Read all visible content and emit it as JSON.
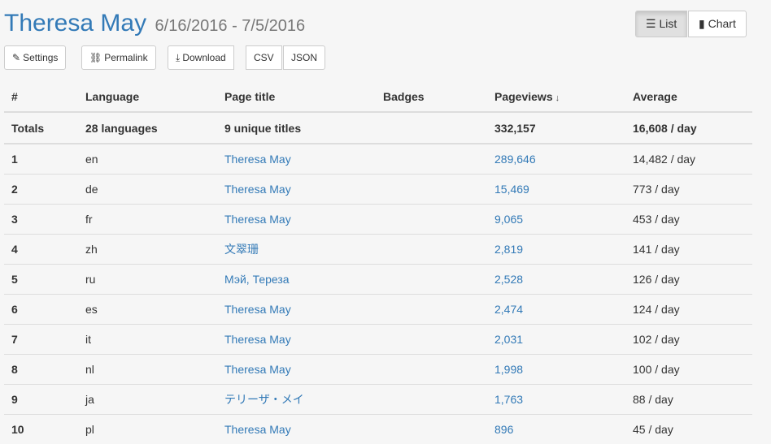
{
  "header": {
    "title": "Theresa May",
    "dates": "6/16/2016 - 7/5/2016"
  },
  "toolbar": {
    "settings_label": "Settings",
    "permalink_label": "Permalink",
    "download_label": "Download",
    "csv_label": "CSV",
    "json_label": "JSON",
    "list_label": "List",
    "chart_label": "Chart"
  },
  "table": {
    "columns": [
      "#",
      "Language",
      "Page title",
      "Badges",
      "Pageviews",
      "Average"
    ],
    "totals": {
      "label": "Totals",
      "languages": "28 languages",
      "titles": "9 unique titles",
      "pageviews": "332,157",
      "average": "16,608 / day"
    },
    "rows": [
      {
        "n": "1",
        "lang": "en",
        "title": "Theresa May",
        "views": "289,646",
        "avg": "14,482 / day"
      },
      {
        "n": "2",
        "lang": "de",
        "title": "Theresa May",
        "views": "15,469",
        "avg": "773 / day"
      },
      {
        "n": "3",
        "lang": "fr",
        "title": "Theresa May",
        "views": "9,065",
        "avg": "453 / day"
      },
      {
        "n": "4",
        "lang": "zh",
        "title": "文翠珊",
        "views": "2,819",
        "avg": "141 / day"
      },
      {
        "n": "5",
        "lang": "ru",
        "title": "Мэй, Тереза",
        "views": "2,528",
        "avg": "126 / day"
      },
      {
        "n": "6",
        "lang": "es",
        "title": "Theresa May",
        "views": "2,474",
        "avg": "124 / day"
      },
      {
        "n": "7",
        "lang": "it",
        "title": "Theresa May",
        "views": "2,031",
        "avg": "102 / day"
      },
      {
        "n": "8",
        "lang": "nl",
        "title": "Theresa May",
        "views": "1,998",
        "avg": "100 / day"
      },
      {
        "n": "9",
        "lang": "ja",
        "title": "テリーザ・メイ",
        "views": "1,763",
        "avg": "88 / day"
      },
      {
        "n": "10",
        "lang": "pl",
        "title": "Theresa May",
        "views": "896",
        "avg": "45 / day"
      }
    ]
  }
}
